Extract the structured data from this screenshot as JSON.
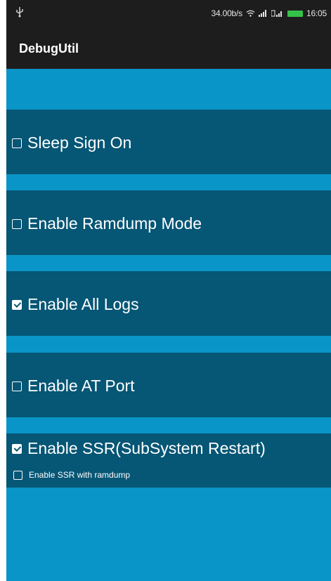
{
  "status_bar": {
    "left_icon": "usb-icon",
    "net_speed": "34.00b/s",
    "wifi_icon": "wifi-icon",
    "signal_icon": "signal-icon",
    "signal2_icon": "signal-2-icon",
    "battery_icon": "battery-icon",
    "time": "16:05"
  },
  "app_bar": {
    "title": "DebugUtil"
  },
  "settings": [
    {
      "label": "Sleep Sign On",
      "checked": false
    },
    {
      "label": "Enable Ramdump Mode",
      "checked": false
    },
    {
      "label": "Enable All Logs",
      "checked": true
    },
    {
      "label": "Enable AT Port",
      "checked": false
    },
    {
      "label": "Enable SSR(SubSystem Restart)",
      "checked": true
    }
  ],
  "ssr_sub_option": {
    "label": "Enable SSR with ramdump",
    "checked": false
  },
  "colors": {
    "background": "#0a95c8",
    "row": "#065675",
    "bar": "#1d1d1d",
    "battery": "#35c24a"
  }
}
